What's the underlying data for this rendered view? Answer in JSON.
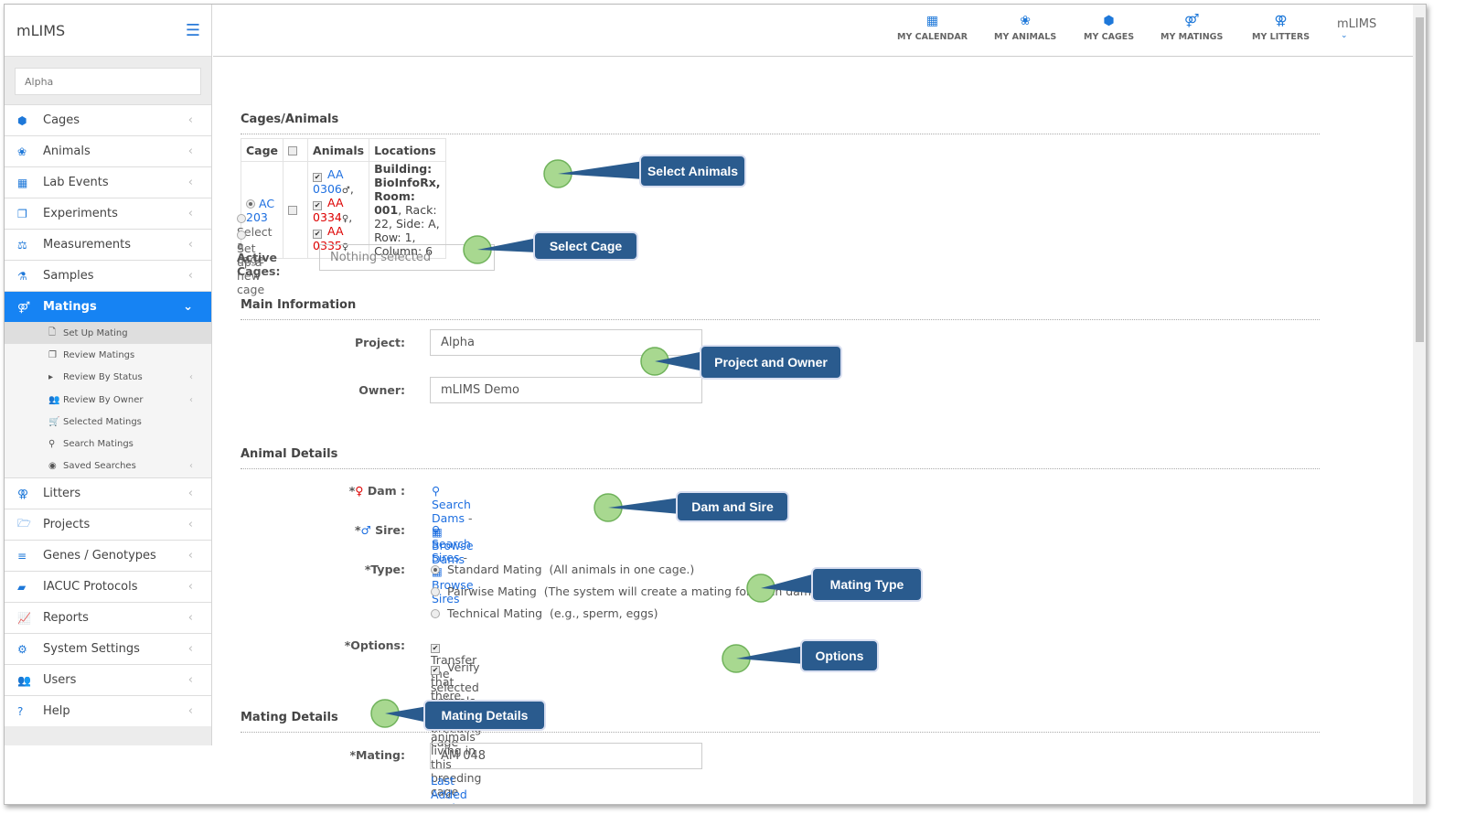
{
  "app": {
    "title": "mLIMS",
    "search_value": "Alpha"
  },
  "sidebar": {
    "items": [
      {
        "label": "Cages",
        "icon": "cube-icon"
      },
      {
        "label": "Animals",
        "icon": "paw-icon"
      },
      {
        "label": "Lab Events",
        "icon": "calendar-icon"
      },
      {
        "label": "Experiments",
        "icon": "copy-icon"
      },
      {
        "label": "Measurements",
        "icon": "balance-icon"
      },
      {
        "label": "Samples",
        "icon": "flask-icon"
      },
      {
        "label": "Matings",
        "icon": "mating-icon",
        "active": true
      }
    ],
    "sub": [
      {
        "label": "Set Up Mating",
        "icon": "file-icon"
      },
      {
        "label": "Review Matings",
        "icon": "copy-icon"
      },
      {
        "label": "Review By Status",
        "icon": "caret-right-icon"
      },
      {
        "label": "Review By Owner",
        "icon": "users-icon"
      },
      {
        "label": "Selected Matings",
        "icon": "cart-icon"
      },
      {
        "label": "Search Matings",
        "icon": "search-icon"
      },
      {
        "label": "Saved Searches",
        "icon": "dot-circle-icon"
      }
    ],
    "items2": [
      {
        "label": "Litters",
        "icon": "litters-icon"
      },
      {
        "label": "Projects",
        "icon": "folder-icon"
      },
      {
        "label": "Genes / Genotypes",
        "icon": "bars-icon"
      },
      {
        "label": "IACUC Protocols",
        "icon": "book-icon"
      },
      {
        "label": "Reports",
        "icon": "chart-icon"
      },
      {
        "label": "System Settings",
        "icon": "gear-icon"
      },
      {
        "label": "Users",
        "icon": "users-icon"
      },
      {
        "label": "Help",
        "icon": "question-icon"
      }
    ]
  },
  "topnav": [
    {
      "label": "MY CALENDAR"
    },
    {
      "label": "MY ANIMALS"
    },
    {
      "label": "MY CAGES"
    },
    {
      "label": "MY MATINGS"
    },
    {
      "label": "MY LITTERS"
    }
  ],
  "user": "mLIMS",
  "cages": {
    "title": "Cages/Animals",
    "headers": [
      "Cage",
      "Animals",
      "Locations"
    ],
    "cage": "AC 203",
    "animals": [
      {
        "id": "AA 0306",
        "sex": "♂"
      },
      {
        "id": "AA 0334",
        "sex": "♀"
      },
      {
        "id": "AA 0335",
        "sex": "♀"
      }
    ],
    "location_building": "Building: BioInfoRx, Room: 001",
    "location_rest": ", Rack: 22, Side: A, Row: 1, Column: 6",
    "select_cage": "Select a cage",
    "new_cage": "Set up a new cage",
    "active_label": "Active Cages:",
    "active_value": "Nothing selected"
  },
  "main_info": {
    "title": "Main Information",
    "project_label": "Project:",
    "project": "Alpha",
    "owner_label": "Owner:",
    "owner": "mLIMS Demo"
  },
  "animal": {
    "title": "Animal Details",
    "dam_label": "Dam :",
    "search_dams": "Search Dams",
    "browse_dams": "Browse Dams",
    "sire_label": "Sire:",
    "search_sires": "Search Sires",
    "browse_sires": "Browse Sires",
    "type_label": "*Type:",
    "types": [
      "Standard Mating  (All animals in one cage.)",
      "Pairwise Mating  (The system will create a mating for each dam/sire pair.)",
      "Technical Mating  (e.g., sperm, eggs)"
    ],
    "options_label": "*Options:",
    "options": [
      "Transfer the selected animals to this breeding cage",
      "Verify that there are no other animals living in this breeding cage"
    ]
  },
  "mating": {
    "title": "Mating Details",
    "label": "*Mating:",
    "value": "AM 048",
    "last": "Last Added Matings"
  },
  "callouts": [
    "Select Animals",
    "Select Cage",
    "Project and Owner",
    "Dam and Sire",
    "Mating Type",
    "Options",
    "Mating Details"
  ],
  "colors": {
    "accent": "#1683f3",
    "callout": "#2a5b8e",
    "marker": "#a8d890"
  }
}
